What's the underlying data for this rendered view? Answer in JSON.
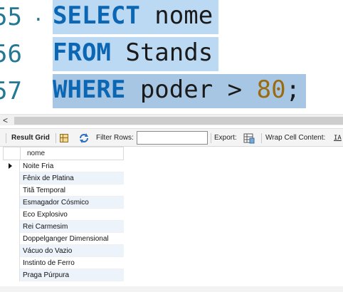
{
  "editor": {
    "lines": [
      {
        "number": "55",
        "marker": "·",
        "tokens": [
          {
            "t": "SELECT",
            "k": "kw"
          },
          {
            "t": " nome",
            "k": "plain"
          }
        ]
      },
      {
        "number": "56",
        "marker": "",
        "tokens": [
          {
            "t": "FROM",
            "k": "kw"
          },
          {
            "t": " Stands",
            "k": "plain"
          }
        ]
      },
      {
        "number": "57",
        "marker": "",
        "tokens": [
          {
            "t": "WHERE",
            "k": "kw"
          },
          {
            "t": " poder > ",
            "k": "plain"
          },
          {
            "t": "80",
            "k": "num"
          },
          {
            "t": ";",
            "k": "plain"
          }
        ]
      }
    ]
  },
  "scrollbar": {
    "arrow": "<"
  },
  "toolbar": {
    "result_grid_label": "Result Grid",
    "filter_label": "Filter Rows:",
    "filter_value": "",
    "export_label": "Export:",
    "wrap_label": "Wrap Cell Content:",
    "wrap_icon": "IA"
  },
  "grid": {
    "column": "nome",
    "rows": [
      "Noite Fria",
      "Fênix de Platina",
      "Titã Temporal",
      "Esmagador Cósmico",
      "Eco Explosivo",
      "Rei Carmesim",
      "Doppelganger Dimensional",
      "Vácuo do Vazio",
      "Instinto de Ferro",
      "Praga Púrpura"
    ],
    "selected_row": 0
  }
}
